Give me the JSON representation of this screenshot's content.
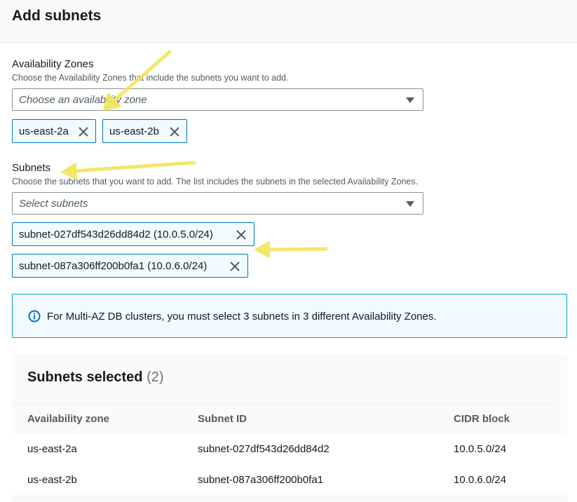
{
  "header": {
    "title": "Add subnets"
  },
  "availability_zones": {
    "label": "Availability Zones",
    "description": "Choose the Availability Zones that include the subnets you want to add.",
    "placeholder": "Choose an availability zone",
    "tokens": [
      "us-east-2a",
      "us-east-2b"
    ]
  },
  "subnets": {
    "label": "Subnets",
    "description": "Choose the subnets that you want to add. The list includes the subnets in the selected Availability Zones.",
    "placeholder": "Select subnets",
    "tokens": [
      "subnet-027df543d26dd84d2 (10.0.5.0/24)",
      "subnet-087a306ff200b0fa1 (10.0.6.0/24)"
    ]
  },
  "info": {
    "message": "For Multi-AZ DB clusters, you must select 3 subnets in 3 different Availability Zones."
  },
  "selected": {
    "title": "Subnets selected",
    "count": "(2)",
    "columns": [
      "Availability zone",
      "Subnet ID",
      "CIDR block"
    ],
    "rows": [
      [
        "us-east-2a",
        "subnet-027df543d26dd84d2",
        "10.0.5.0/24"
      ],
      [
        "us-east-2b",
        "subnet-087a306ff200b0fa1",
        "10.0.6.0/24"
      ]
    ]
  },
  "colors": {
    "accent": "#0073bb",
    "info_border": "#00a1c9",
    "annotation_arrow": "#f2e55c"
  },
  "icons": {
    "dropdown": "caret-down-icon",
    "remove": "close-icon",
    "info": "info-icon",
    "annotation": "arrow-icon"
  }
}
